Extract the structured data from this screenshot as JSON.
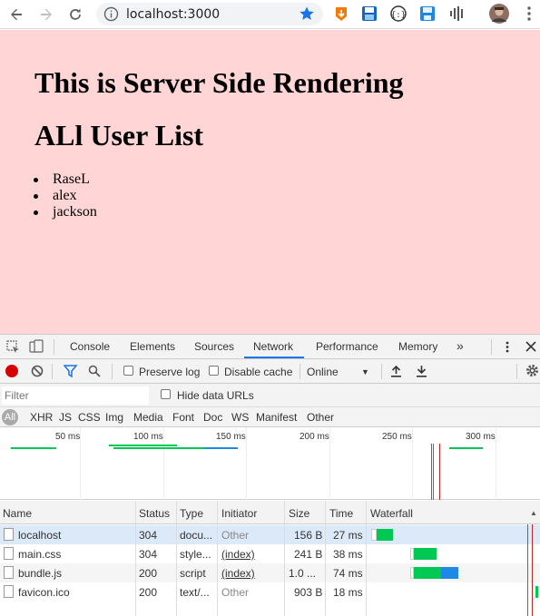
{
  "browser": {
    "url": "localhost:3000",
    "icons": [
      "back-icon",
      "forward-icon",
      "reload-icon",
      "info-icon",
      "star-icon",
      "menu-icon"
    ]
  },
  "page": {
    "heading": "This is Server Side Rendering",
    "subheading": "ALl User List",
    "users": [
      "RaseL",
      "alex",
      "jackson"
    ]
  },
  "devtools": {
    "tabs": [
      "Console",
      "Elements",
      "Sources",
      "Network",
      "Performance",
      "Memory"
    ],
    "more": "»",
    "active_tab": "Network",
    "toolbar": {
      "preserve_log": "Preserve log",
      "disable_cache": "Disable cache",
      "throttle": "Online",
      "throttle_arrow": "▼"
    },
    "filter": {
      "placeholder": "Filter",
      "hide_data_urls": "Hide data URLs"
    },
    "types": [
      "All",
      "XHR",
      "JS",
      "CSS",
      "Img",
      "Media",
      "Font",
      "Doc",
      "WS",
      "Manifest",
      "Other"
    ],
    "overview_ticks": [
      "50 ms",
      "100 ms",
      "150 ms",
      "200 ms",
      "250 ms",
      "300 ms"
    ],
    "columns": [
      "Name",
      "Status",
      "Type",
      "Initiator",
      "Size",
      "Time",
      "Waterfall"
    ],
    "rows": [
      {
        "name": "localhost",
        "status": "304",
        "type": "docu...",
        "initiator": "Other",
        "size": "156 B",
        "time": "27 ms"
      },
      {
        "name": "main.css",
        "status": "304",
        "type": "style...",
        "initiator": "(index)",
        "size": "241 B",
        "time": "38 ms"
      },
      {
        "name": "bundle.js",
        "status": "200",
        "type": "script",
        "initiator": "(index)",
        "size": "1.0 ...",
        "time": "74 ms"
      },
      {
        "name": "favicon.ico",
        "status": "200",
        "type": "text/...",
        "initiator": "Other",
        "size": "903 B",
        "time": "18 ms"
      }
    ],
    "colors": {
      "waiting": "#00c853",
      "download": "#1e88e5",
      "dom_line": "#1a73e8",
      "load_line": "#c62828"
    }
  }
}
